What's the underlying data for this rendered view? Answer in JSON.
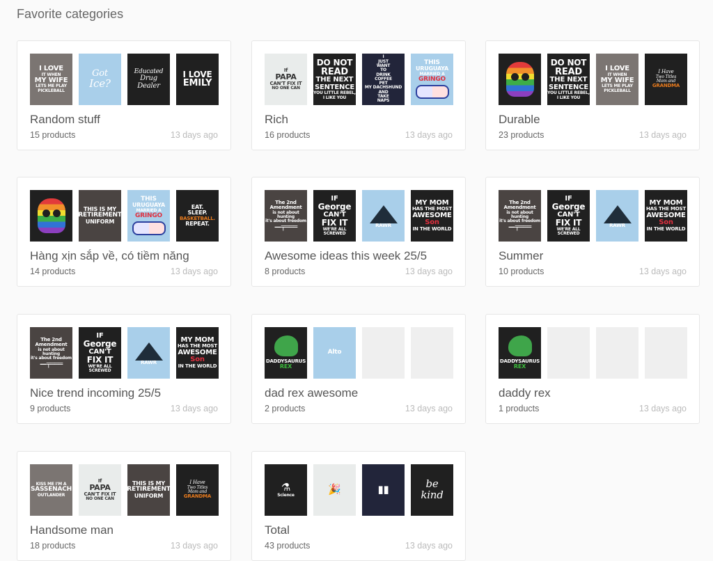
{
  "section_title": "Favorite categories",
  "categories": [
    {
      "name": "Random stuff",
      "products": "15 products",
      "updated": "13 days ago",
      "thumbs": [
        {
          "style": "t-grey",
          "lines": [
            [
              "I LOVE",
              "s10"
            ],
            [
              "IT WHEN",
              "s6"
            ],
            [
              "MY WIFE",
              "s10"
            ],
            [
              "LETS ME PLAY PICKLEBALL",
              "s6"
            ]
          ]
        },
        {
          "style": "t-sky",
          "lines": [
            [
              "Got",
              "s13 script"
            ],
            [
              "Ice?",
              "s15 script"
            ]
          ]
        },
        {
          "style": "t-dark",
          "lines": [
            [
              "Educated",
              "s9 script"
            ],
            [
              "Drug",
              "s10 script"
            ],
            [
              "Dealer",
              "s10 script"
            ]
          ]
        },
        {
          "style": "t-dark",
          "lines": [
            [
              "I LOVE",
              "s12"
            ],
            [
              "EMILY",
              "s13"
            ]
          ]
        }
      ]
    },
    {
      "name": "Rich",
      "products": "16 products",
      "updated": "13 days ago",
      "thumbs": [
        {
          "style": "t-light",
          "lines": [
            [
              "If",
              "s7"
            ],
            [
              "PAPA",
              "s11"
            ],
            [
              "CAN'T FIX IT",
              "s7"
            ],
            [
              "NO ONE CAN",
              "s6"
            ]
          ]
        },
        {
          "style": "t-dark",
          "lines": [
            [
              "DO NOT",
              "s12"
            ],
            [
              "READ",
              "s13"
            ],
            [
              "THE NEXT",
              "s10"
            ],
            [
              "SENTENCE",
              "s10"
            ],
            [
              "YOU LITTLE REBEL, I LIKE YOU",
              "s6"
            ]
          ]
        },
        {
          "style": "t-navy",
          "lines": [
            [
              "I",
              "s6"
            ],
            [
              "JUST",
              "s6"
            ],
            [
              "WANT",
              "s6"
            ],
            [
              "TO",
              "s6"
            ],
            [
              "DRINK",
              "s6"
            ],
            [
              "COFFEE",
              "s6"
            ],
            [
              "PET",
              "s6"
            ],
            [
              "MY DACHSHUND",
              "s6"
            ],
            [
              "AND",
              "s6"
            ],
            [
              "TAKE",
              "s6"
            ],
            [
              "NAPS",
              "s6"
            ]
          ]
        },
        {
          "style": "t-sky",
          "lines": [
            [
              "THIS",
              "s9"
            ],
            [
              "URUGUAYA",
              "s8"
            ],
            [
              "MARRIED A",
              "s6"
            ],
            [
              "GRINGO",
              "s9 acc-red"
            ]
          ],
          "flag": true
        }
      ]
    },
    {
      "name": "Durable",
      "products": "23 products",
      "updated": "13 days ago",
      "thumbs": [
        {
          "style": "t-dark",
          "skull": true,
          "lines": []
        },
        {
          "style": "t-dark",
          "lines": [
            [
              "DO NOT",
              "s12"
            ],
            [
              "READ",
              "s13"
            ],
            [
              "THE NEXT",
              "s10"
            ],
            [
              "SENTENCE",
              "s10"
            ],
            [
              "YOU LITTLE REBEL, I LIKE YOU",
              "s6"
            ]
          ]
        },
        {
          "style": "t-grey",
          "lines": [
            [
              "I LOVE",
              "s10"
            ],
            [
              "IT WHEN",
              "s6"
            ],
            [
              "MY WIFE",
              "s10"
            ],
            [
              "LETS ME PLAY PICKLEBALL",
              "s6"
            ]
          ]
        },
        {
          "style": "t-dark",
          "lines": [
            [
              "I Have",
              "s7 script"
            ],
            [
              "Two Titles",
              "s6 script"
            ],
            [
              "Mom and",
              "s6 script"
            ],
            [
              "GRANDMA",
              "s7 acc-org"
            ]
          ]
        }
      ]
    },
    {
      "name": "Hàng xịn sắp về, có tiềm năng",
      "products": "14 products",
      "updated": "13 days ago",
      "thumbs": [
        {
          "style": "t-dark",
          "skull": true,
          "lines": []
        },
        {
          "style": "t-brown",
          "lines": [
            [
              "THIS IS MY",
              "s8"
            ],
            [
              "RETIREMENT",
              "s9"
            ],
            [
              "UNIFORM",
              "s8"
            ]
          ]
        },
        {
          "style": "t-sky",
          "lines": [
            [
              "THIS",
              "s9"
            ],
            [
              "URUGUAYA",
              "s8"
            ],
            [
              "MARRIED A",
              "s6"
            ],
            [
              "GRINGO",
              "s9 acc-red"
            ]
          ],
          "flag": true
        },
        {
          "style": "t-dark",
          "lines": [
            [
              "EAT.",
              "s8"
            ],
            [
              "SLEEP.",
              "s8"
            ],
            [
              "BASKETBALL.",
              "s7 acc-org"
            ],
            [
              "REPEAT.",
              "s8"
            ]
          ]
        }
      ]
    },
    {
      "name": "Awesome ideas this week 25/5",
      "products": "8 products",
      "updated": "13 days ago",
      "thumbs": [
        {
          "style": "t-brown",
          "lines": [
            [
              "The 2nd Amendment",
              "s7"
            ],
            [
              "is not about hunting",
              "s6"
            ],
            [
              "it's about freedom",
              "s6"
            ],
            [
              "—╤═══",
              "s10"
            ]
          ]
        },
        {
          "style": "t-dark",
          "lines": [
            [
              "IF",
              "s10"
            ],
            [
              "George",
              "s12"
            ],
            [
              "CAN'T",
              "s10"
            ],
            [
              "FIX IT",
              "s12"
            ],
            [
              "WE'RE ALL SCREWED",
              "s6"
            ]
          ]
        },
        {
          "style": "t-sky",
          "lines": [
            [
              "RAWR",
              "s7"
            ]
          ],
          "mountain": true
        },
        {
          "style": "t-dark",
          "lines": [
            [
              "MY MOM",
              "s10"
            ],
            [
              "HAS THE MOST",
              "s7"
            ],
            [
              "AWESOME",
              "s10"
            ],
            [
              "Son",
              "s10 acc-red"
            ],
            [
              "IN THE WORLD",
              "s7"
            ]
          ]
        }
      ]
    },
    {
      "name": "Summer",
      "products": "10 products",
      "updated": "13 days ago",
      "thumbs": [
        {
          "style": "t-brown",
          "lines": [
            [
              "The 2nd Amendment",
              "s7"
            ],
            [
              "is not about hunting",
              "s6"
            ],
            [
              "it's about freedom",
              "s6"
            ],
            [
              "—╤═══",
              "s10"
            ]
          ]
        },
        {
          "style": "t-dark",
          "lines": [
            [
              "IF",
              "s10"
            ],
            [
              "George",
              "s12"
            ],
            [
              "CAN'T",
              "s10"
            ],
            [
              "FIX IT",
              "s12"
            ],
            [
              "WE'RE ALL SCREWED",
              "s6"
            ]
          ]
        },
        {
          "style": "t-sky",
          "lines": [
            [
              "RAWR",
              "s7"
            ]
          ],
          "mountain": true
        },
        {
          "style": "t-dark",
          "lines": [
            [
              "MY MOM",
              "s10"
            ],
            [
              "HAS THE MOST",
              "s7"
            ],
            [
              "AWESOME",
              "s10"
            ],
            [
              "Son",
              "s10 acc-red"
            ],
            [
              "IN THE WORLD",
              "s7"
            ]
          ]
        }
      ]
    },
    {
      "name": "Nice trend incoming 25/5",
      "products": "9 products",
      "updated": "13 days ago",
      "thumbs": [
        {
          "style": "t-brown",
          "lines": [
            [
              "The 2nd Amendment",
              "s7"
            ],
            [
              "is not about hunting",
              "s6"
            ],
            [
              "it's about freedom",
              "s6"
            ],
            [
              "—╤═══",
              "s10"
            ]
          ]
        },
        {
          "style": "t-dark",
          "lines": [
            [
              "IF",
              "s10"
            ],
            [
              "George",
              "s12"
            ],
            [
              "CAN'T",
              "s10"
            ],
            [
              "FIX IT",
              "s12"
            ],
            [
              "WE'RE ALL SCREWED",
              "s6"
            ]
          ]
        },
        {
          "style": "t-sky",
          "lines": [
            [
              "RAWR",
              "s7"
            ]
          ],
          "mountain": true
        },
        {
          "style": "t-dark",
          "lines": [
            [
              "MY MOM",
              "s10"
            ],
            [
              "HAS THE MOST",
              "s7"
            ],
            [
              "AWESOME",
              "s10"
            ],
            [
              "Son",
              "s10 acc-red"
            ],
            [
              "IN THE WORLD",
              "s7"
            ]
          ]
        }
      ]
    },
    {
      "name": "dad rex awesome",
      "products": "2 products",
      "updated": "13 days ago",
      "thumbs": [
        {
          "style": "t-dark",
          "dino": true,
          "lines": [
            [
              "DADDYSAURUS",
              "s7"
            ],
            [
              "REX",
              "s8 acc-grn"
            ]
          ]
        },
        {
          "style": "t-sky",
          "lines": [
            [
              "Alto",
              "s9"
            ]
          ]
        },
        {
          "style": "t-empty",
          "lines": []
        },
        {
          "style": "t-empty",
          "lines": []
        }
      ]
    },
    {
      "name": "daddy rex",
      "products": "1 products",
      "updated": "13 days ago",
      "thumbs": [
        {
          "style": "t-dark",
          "dino": true,
          "lines": [
            [
              "DADDYSAURUS",
              "s7"
            ],
            [
              "REX",
              "s8 acc-grn"
            ]
          ]
        },
        {
          "style": "t-empty",
          "lines": []
        },
        {
          "style": "t-empty",
          "lines": []
        },
        {
          "style": "t-empty",
          "lines": []
        }
      ]
    },
    {
      "name": "Handsome man",
      "products": "18 products",
      "updated": "13 days ago",
      "thumbs": [
        {
          "style": "t-grey",
          "lines": [
            [
              "KISS ME I'M A",
              "s6"
            ],
            [
              "SASSENACH",
              "s9"
            ],
            [
              "OUTLANDER",
              "s6"
            ]
          ]
        },
        {
          "style": "t-light",
          "lines": [
            [
              "If",
              "s7"
            ],
            [
              "PAPA",
              "s11"
            ],
            [
              "CAN'T FIX IT",
              "s7"
            ],
            [
              "NO ONE CAN",
              "s6"
            ]
          ]
        },
        {
          "style": "t-brown",
          "lines": [
            [
              "THIS IS MY",
              "s8"
            ],
            [
              "RETIREMENT",
              "s9"
            ],
            [
              "UNIFORM",
              "s8"
            ]
          ]
        },
        {
          "style": "t-dark",
          "lines": [
            [
              "I Have",
              "s7 script"
            ],
            [
              "Two Titles",
              "s6 script"
            ],
            [
              "Mom and",
              "s6 script"
            ],
            [
              "GRANDMA",
              "s7 acc-org"
            ]
          ]
        }
      ]
    },
    {
      "name": "Total",
      "products": "43 products",
      "updated": "13 days ago",
      "thumbs": [
        {
          "style": "t-dark",
          "lines": [
            [
              "⚗",
              "s15"
            ],
            [
              "Science",
              "s6"
            ]
          ]
        },
        {
          "style": "t-light",
          "lines": [
            [
              "🎉",
              "s15"
            ]
          ]
        },
        {
          "style": "t-navy",
          "lines": [
            [
              "▮▮",
              "s15"
            ]
          ]
        },
        {
          "style": "t-dark",
          "lines": [
            [
              "be",
              "s15 script"
            ],
            [
              "kind",
              "s15 script"
            ]
          ]
        }
      ]
    }
  ]
}
